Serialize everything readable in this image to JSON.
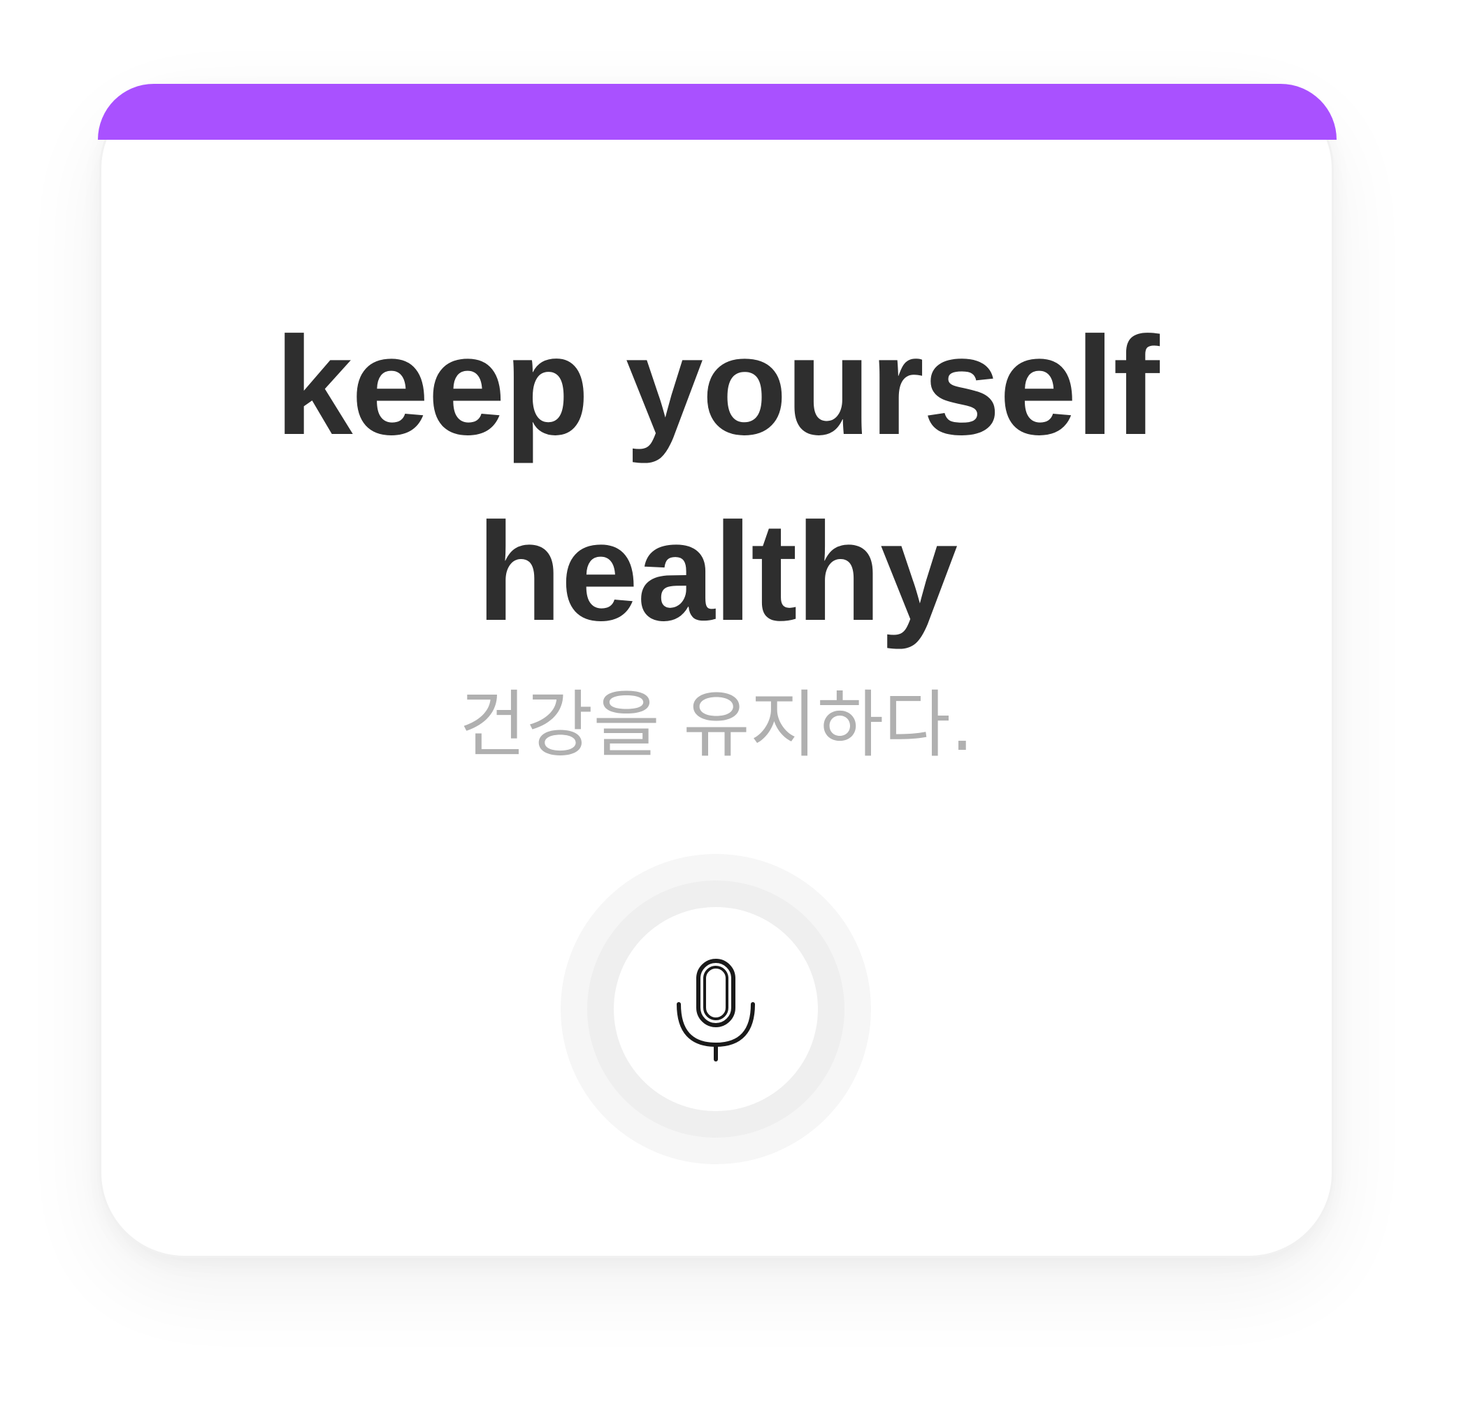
{
  "colors": {
    "accent": "#a951ff",
    "word_text": "#2e2e2e",
    "meaning_text": "#b0b0b0"
  },
  "flashcard": {
    "word": "keep yourself healthy",
    "meaning": "건강을 유지하다."
  },
  "mic": {
    "icon": "microphone-icon"
  }
}
